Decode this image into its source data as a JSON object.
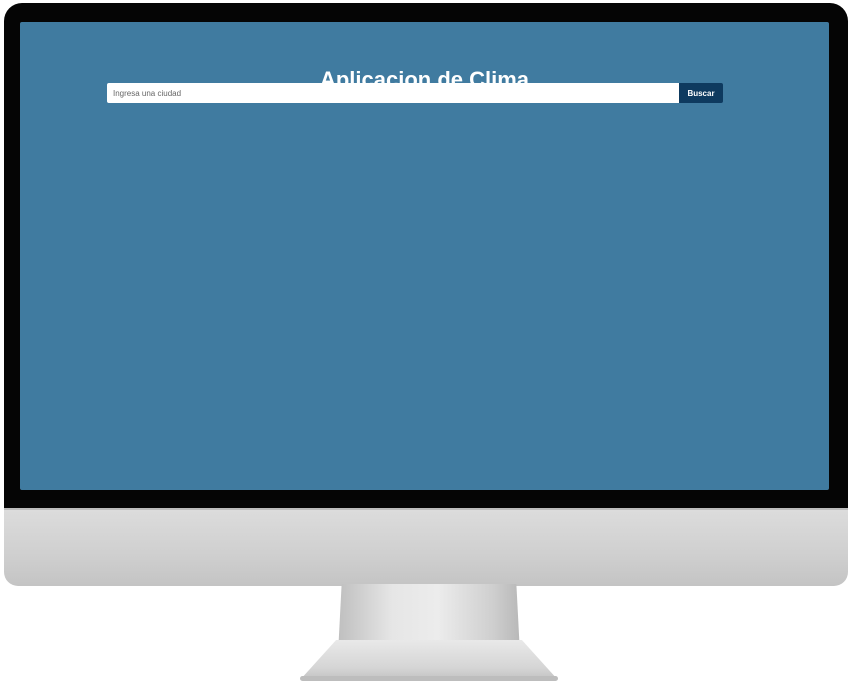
{
  "app": {
    "title": "Aplicacion de Clima"
  },
  "search": {
    "placeholder": "Ingresa una ciudad",
    "value": "",
    "button_label": "Buscar"
  },
  "colors": {
    "screen_background": "#407ba0",
    "button_background": "#0e3a5f",
    "title_text": "#ffffff",
    "monitor_bezel": "#050505",
    "monitor_body": "#d6d6d6"
  }
}
